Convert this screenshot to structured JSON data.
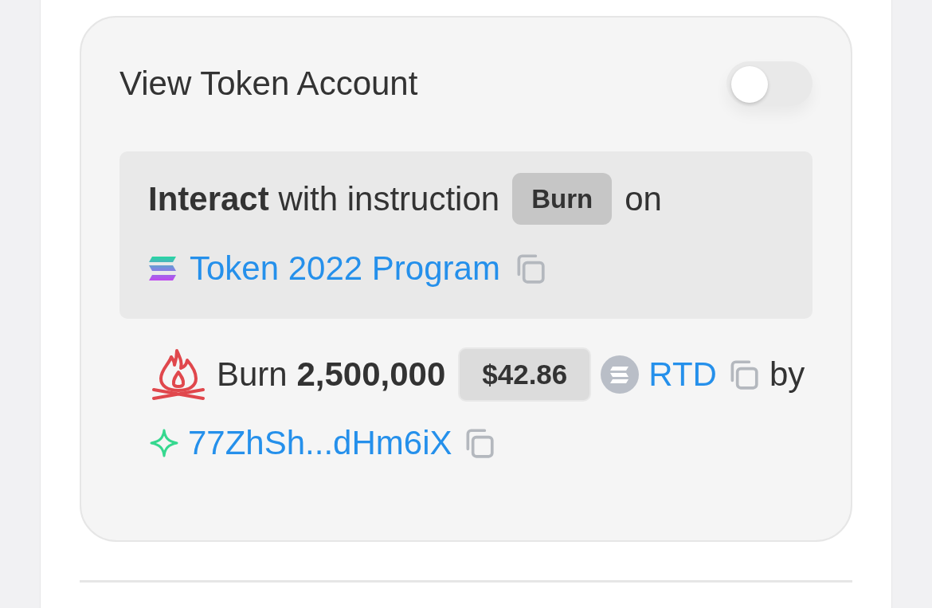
{
  "settings": {
    "title": "View Token Account",
    "toggle": {
      "on": false
    }
  },
  "instruction": {
    "text": "**Interact** with instruction",
    "instruction_name": "Burn",
    "connector": "on",
    "program": {
      "name": "Token 2022 Program"
    }
  },
  "action": {
    "text": "Burn **2,500,000**",
    "usd_value": "$42.86",
    "token": {
      "symbol": "RTD"
    },
    "connector": "by",
    "authority": {
      "address": "77ZhSh...dHm6iX"
    }
  }
}
